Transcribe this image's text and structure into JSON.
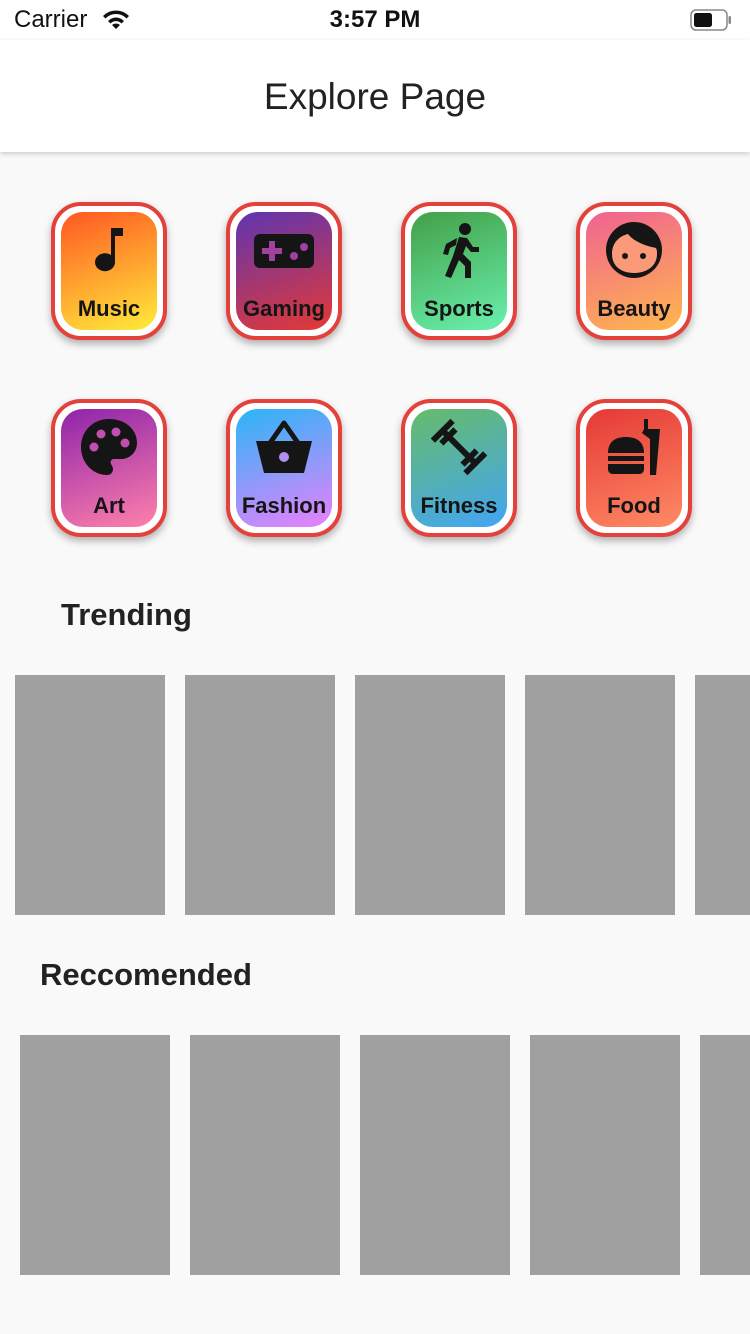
{
  "status_bar": {
    "carrier": "Carrier",
    "time": "3:57 PM"
  },
  "nav": {
    "title": "Explore Page"
  },
  "categories": [
    {
      "label": "Music",
      "icon": "music-note-icon",
      "colors": [
        "#ff5722",
        "#ffeb3b"
      ]
    },
    {
      "label": "Gaming",
      "icon": "gamepad-icon",
      "colors": [
        "#5e35b1",
        "#e53935"
      ]
    },
    {
      "label": "Sports",
      "icon": "running-person-icon",
      "colors": [
        "#43a047",
        "#69f0ae"
      ]
    },
    {
      "label": "Beauty",
      "icon": "face-icon",
      "colors": [
        "#f06292",
        "#ffb74d"
      ]
    },
    {
      "label": "Art",
      "icon": "palette-icon",
      "colors": [
        "#8e24aa",
        "#ff80ab"
      ]
    },
    {
      "label": "Fashion",
      "icon": "shopping-basket-icon",
      "colors": [
        "#29b6f6",
        "#ea80fc"
      ]
    },
    {
      "label": "Fitness",
      "icon": "dumbbell-icon",
      "colors": [
        "#66bb6a",
        "#42a5f5"
      ]
    },
    {
      "label": "Food",
      "icon": "fastfood-icon",
      "colors": [
        "#e53935",
        "#ff8a65"
      ]
    }
  ],
  "sections": {
    "trending": "Trending",
    "recommended": "Reccomended"
  },
  "colors": {
    "tile_border": "#e4413b",
    "card_placeholder": "#a0a0a0",
    "background": "#f9f9f9"
  }
}
